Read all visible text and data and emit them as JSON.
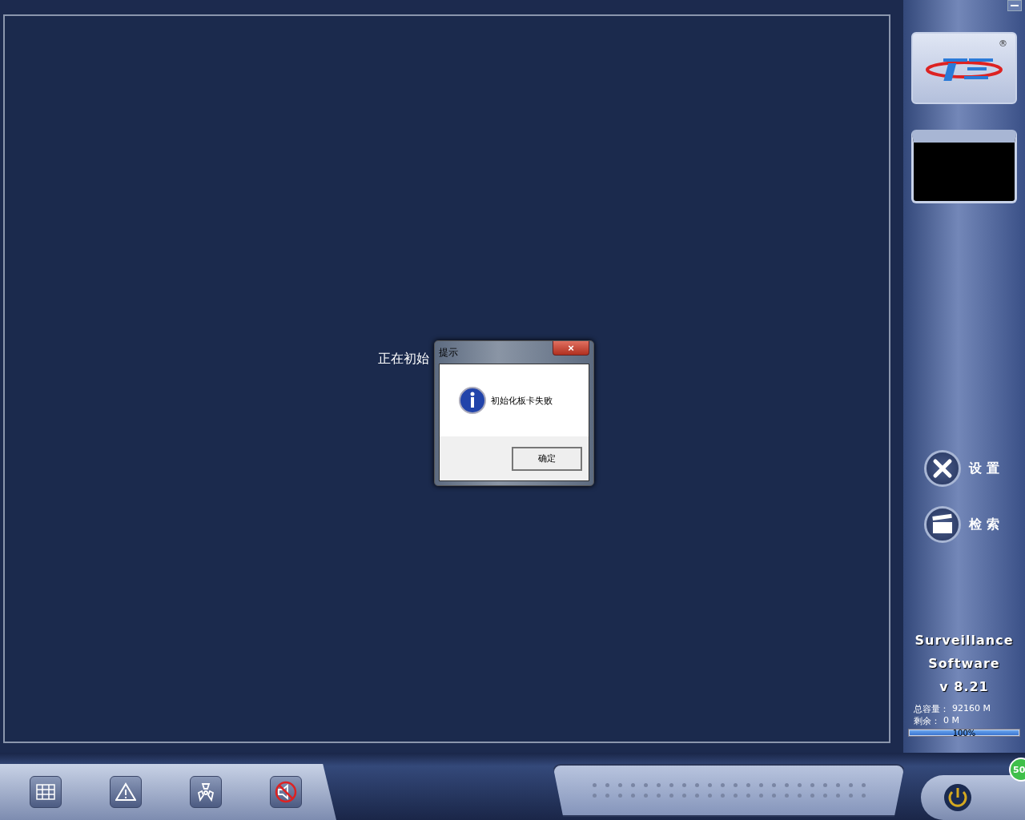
{
  "status_text": "正在初始",
  "dialog": {
    "title": "提示",
    "close": "×",
    "message": "初始化板卡失败",
    "button": "确定"
  },
  "sidebar": {
    "menu": [
      {
        "kind": "settings",
        "label": "设 置"
      },
      {
        "kind": "search",
        "label": "检 索"
      }
    ],
    "product": [
      "Surveillance",
      "Software",
      "v 8.21"
    ],
    "capacity": {
      "total_label": "总容量：",
      "total": "92160 M",
      "free_label": "剩余：",
      "free": "0 M"
    },
    "usage": {
      "level": 1,
      "reading": "100%"
    }
  },
  "toolbar": [
    {
      "kind": "grid"
    },
    {
      "kind": "alarm"
    },
    {
      "kind": "ptz"
    },
    {
      "kind": "mute"
    }
  ],
  "badge": "50",
  "logo": {
    "mark": "®"
  }
}
